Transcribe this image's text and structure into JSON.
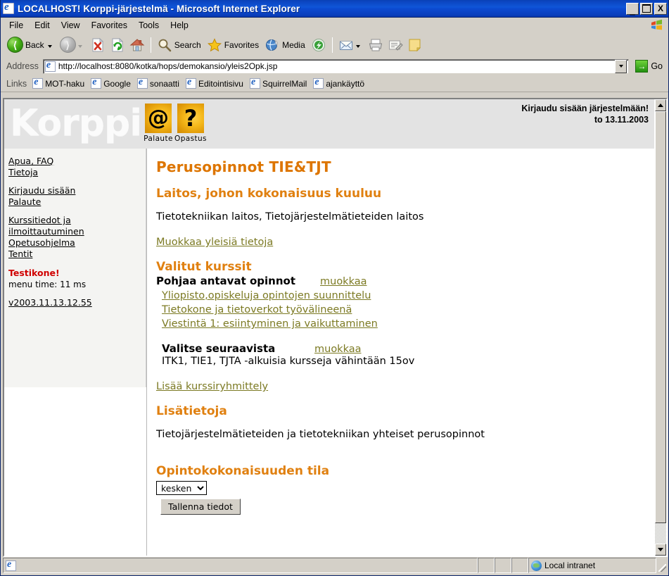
{
  "window": {
    "title": "LOCALHOST! Korppi-järjestelmä - Microsoft Internet Explorer",
    "minimize_label": "_",
    "maximize_label": "",
    "close_label": "X"
  },
  "menu": {
    "items": [
      {
        "label": "File"
      },
      {
        "label": "Edit"
      },
      {
        "label": "View"
      },
      {
        "label": "Favorites"
      },
      {
        "label": "Tools"
      },
      {
        "label": "Help"
      }
    ]
  },
  "toolbar": {
    "back_label": "Back",
    "forward_label": "",
    "stop_icon": "stop-icon",
    "refresh_icon": "refresh-icon",
    "home_icon": "home-icon",
    "search_label": "Search",
    "favorites_label": "Favorites",
    "media_label": "Media",
    "history_icon": "history-icon",
    "mail_icon": "mail-icon",
    "print_icon": "print-icon",
    "edit_icon": "edit-icon",
    "discuss_icon": "notes-icon"
  },
  "address": {
    "label": "Address",
    "value": "http://localhost:8080/kotka/hops/demokansio/yleis2Opk.jsp",
    "placeholder": "",
    "go_label": "Go"
  },
  "links": {
    "label": "Links",
    "items": [
      {
        "label": "MOT-haku"
      },
      {
        "label": "Google"
      },
      {
        "label": "sonaatti"
      },
      {
        "label": "Editointisivu"
      },
      {
        "label": "SquirrelMail"
      },
      {
        "label": "ajankäyttö"
      }
    ]
  },
  "page_header": {
    "logo_text": "Korppi",
    "icons": [
      {
        "glyph": "@",
        "label": "Palaute",
        "name": "palaute-icon"
      },
      {
        "glyph": "?",
        "label": "Opastus",
        "name": "opastus-icon"
      }
    ],
    "login_notice": "Kirjaudu sisään järjestelmään!",
    "date": "to 13.11.2003"
  },
  "sidebar": {
    "group1": [
      {
        "label": "Apua, FAQ"
      },
      {
        "label": "Tietoja"
      }
    ],
    "group2": [
      {
        "label": "Kirjaudu sisään"
      },
      {
        "label": "Palaute"
      }
    ],
    "group3": [
      {
        "label": "Kurssitiedot ja"
      },
      {
        "label": "ilmoittautuminen"
      },
      {
        "label": "Opetusohjelma"
      },
      {
        "label": "Tentit"
      }
    ],
    "alert": "Testikone!",
    "menu_time": "menu time: 11 ms",
    "version": "v2003.11.13.12.55"
  },
  "content": {
    "title": "Perusopinnot TIE&TJT",
    "section_department": {
      "heading": "Laitos, johon kokonaisuus kuuluu",
      "value": "Tietotekniikan laitos, Tietojärjestelmätieteiden laitos",
      "edit_link": "Muokkaa yleisiä tietoja"
    },
    "section_courses": {
      "heading": "Valitut kurssit",
      "groups": [
        {
          "label": "Pohjaa antavat opinnot",
          "edit_link": "muokkaa",
          "courses": [
            {
              "name": "Yliopisto,opiskeluja opintojen suunnittelu"
            },
            {
              "name": "Tietokone ja tietoverkot työvälineenä"
            },
            {
              "name": "Viestintä 1: esiintyminen ja vaikuttaminen"
            }
          ],
          "note": ""
        },
        {
          "label": "Valitse seuraavista",
          "edit_link": "muokkaa",
          "courses": [],
          "note": "ITK1, TIE1, TJTA -alkuisia kursseja vähintään 15ov"
        }
      ],
      "add_link": "Lisää kurssiryhmittely"
    },
    "section_info": {
      "heading": "Lisätietoja",
      "value": "Tietojärjestelmätieteiden ja tietotekniikan yhteiset perusopinnot"
    },
    "section_status": {
      "heading": "Opintokokonaisuuden tila",
      "selected": "kesken",
      "options": [
        "kesken"
      ],
      "save_label": "Tallenna tiedot"
    }
  },
  "statusbar": {
    "message": "",
    "zone": "Local intranet"
  },
  "colors": {
    "heading": "#dd7500",
    "subheading": "#e08010",
    "link": "#7c7a23",
    "alert": "#d00000",
    "titlebar": "#0b45c0"
  }
}
